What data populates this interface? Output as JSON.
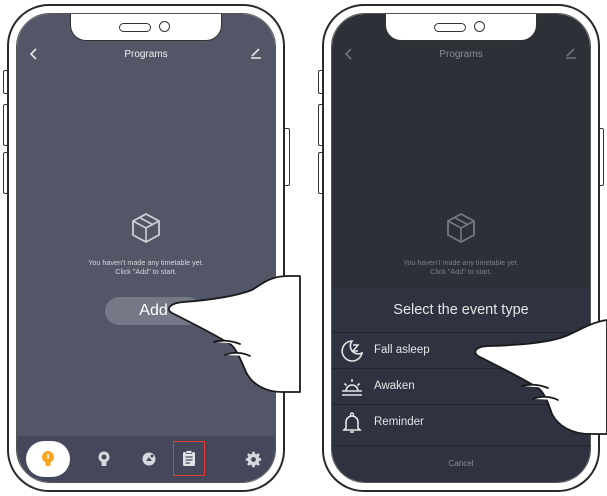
{
  "left_screen": {
    "header": {
      "back_icon": "chevron-left-icon",
      "title": "Programs",
      "edit_icon": "pencil-icon"
    },
    "empty": {
      "icon": "box-icon",
      "line1": "You haven't made any timetable yet.",
      "line2": "Click \"Add\" to start."
    },
    "add_label": "Add",
    "tabs": [
      {
        "icon": "bulb-icon",
        "active": true
      },
      {
        "icon": "bulb-outline-icon",
        "active": false
      },
      {
        "icon": "scene-icon",
        "active": false
      },
      {
        "icon": "clipboard-icon",
        "active": false,
        "highlighted": true
      },
      {
        "icon": "gear-icon",
        "active": false
      }
    ],
    "colors": {
      "background": "#525666",
      "tabbar": "#44485a",
      "accent": "#f5a623",
      "highlight": "#e53935"
    }
  },
  "right_screen": {
    "header": {
      "back_icon": "chevron-left-icon",
      "title": "Programs",
      "edit_icon": "pencil-icon"
    },
    "empty": {
      "icon": "box-icon",
      "line1": "You haven't made any timetable yet.",
      "line2": "Click \"Add\" to start."
    },
    "sheet": {
      "title": "Select the event type",
      "options": [
        {
          "icon": "moon-z-icon",
          "label": "Fall asleep"
        },
        {
          "icon": "sunrise-icon",
          "label": "Awaken"
        },
        {
          "icon": "bell-icon",
          "label": "Reminder"
        }
      ],
      "cancel": "Cancel"
    },
    "colors": {
      "background": "#2e3038",
      "sheet": "#2f3240"
    }
  }
}
